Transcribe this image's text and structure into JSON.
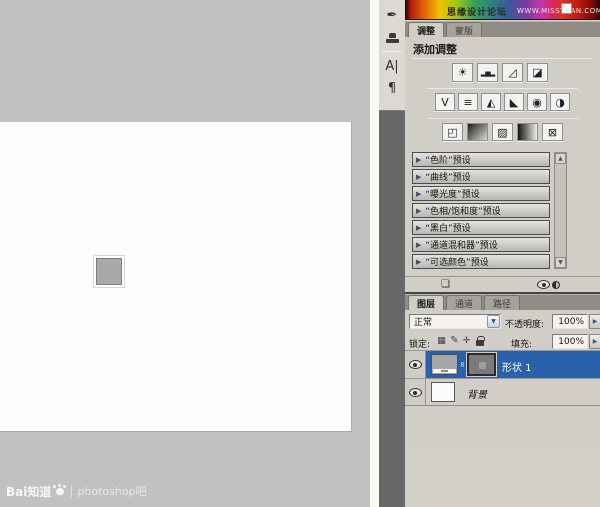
{
  "colors": {
    "selection_blue": "#2a61ab",
    "panel_background": "#d1cec7",
    "pasteboard_gray": "#c1c1c1",
    "canvas_white": "#fdfdfb"
  },
  "watermark_bar": {
    "site_name": "思缘设计论坛",
    "site_url": "WWW.MISSYUAN.COM"
  },
  "toolbar": {
    "tool_brush_glyph": "✒",
    "tool_type_glyph": "A|",
    "tool_paragraph_glyph": "¶"
  },
  "icons": {
    "brightness_contrast": "☀",
    "levels": "▂▅▂",
    "curves": "◿",
    "exposure": "◪",
    "vibrance": "V",
    "hue_saturation": "≡",
    "color_balance": "◭",
    "black_white": "◣",
    "photo_filter": "◉",
    "channel_mixer": "◑",
    "invert": "◰",
    "threshold": "▨",
    "selective_color": "⊠",
    "expander": "▶",
    "scroll_up": "▲",
    "scroll_down": "▼",
    "dropdown_chevron": "▼",
    "stepper_arrow": "▶",
    "lock_transparent": "▦",
    "lock_paint": "✎",
    "lock_move": "✛",
    "panel_list": "❏"
  },
  "adjustments_panel": {
    "tabs": [
      {
        "label": "调整"
      },
      {
        "label": "蒙版"
      }
    ],
    "title": "添加调整",
    "presets": [
      "“色阶”预设",
      "“曲线”预设",
      "“曝光度”预设",
      "“色相/饱和度”预设",
      "“黑白”预设",
      "“通道混和器”预设",
      "“可选颜色”预设"
    ]
  },
  "layers_panel": {
    "tabs": [
      {
        "label": "图层"
      },
      {
        "label": "通道"
      },
      {
        "label": "路径"
      }
    ],
    "blend_mode": "正常",
    "opacity_label": "不透明度:",
    "opacity_value": "100%",
    "lock_label": "锁定:",
    "fill_label": "填充:",
    "fill_value": "100%",
    "layers": [
      {
        "name": "形状 1"
      },
      {
        "name": "背景"
      }
    ]
  },
  "footer_watermark": {
    "brand": "Bai知道",
    "separator": "|",
    "community": "photoshop吧"
  }
}
